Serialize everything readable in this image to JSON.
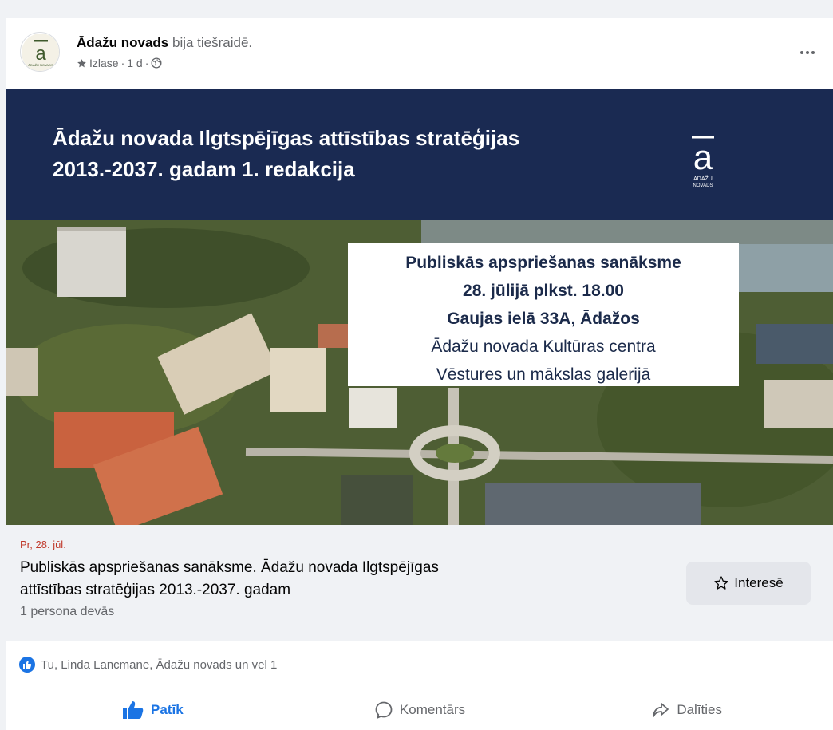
{
  "post": {
    "author": "Ādažu novads",
    "action": "bija tiešraidē.",
    "meta": {
      "icon": "star-icon",
      "audience": "Izlase",
      "sep1": "·",
      "time": "1 d",
      "sep2": "·",
      "privacy_icon": "globe-icon"
    },
    "logo": {
      "letter": "ā",
      "small_text": "ĀDAŽU NOVADS"
    }
  },
  "banner": {
    "title_line1": "Ādažu novada Ilgtspējīgas attīstības stratēģijas",
    "title_line2": "2013.-2037. gadam 1. redakcija",
    "logo_letter": "ā",
    "logo_line1": "ĀDAŽU",
    "logo_line2": "NOVADS",
    "background": "#1a2a52"
  },
  "overlay": {
    "line1": "Publiskās apspriešanas sanāksme",
    "line2": "28. jūlijā plkst. 18.00",
    "line3": "Gaujas ielā 33A, Ādažos",
    "line4": "Ādažu novada Kultūras centra",
    "line5": "Vēstures un mākslas galerijā"
  },
  "event": {
    "date": "Pr, 28. jūl.",
    "title_line1": "Publiskās apspriešanas sanāksme. Ādažu novada Ilgtspējīgas",
    "title_line2": "attīstības stratēģijas 2013.-2037. gadam",
    "going": "1 persona devās",
    "interested_label": "Interesē"
  },
  "reactions": {
    "text": "Tu, Linda Lancmane, Ādažu novads un vēl 1"
  },
  "actions": {
    "like": "Patīk",
    "comment": "Komentārs",
    "share": "Dalīties"
  },
  "colors": {
    "accent": "#1b74e4",
    "event_date": "#c0392b",
    "banner": "#1a2a52"
  }
}
